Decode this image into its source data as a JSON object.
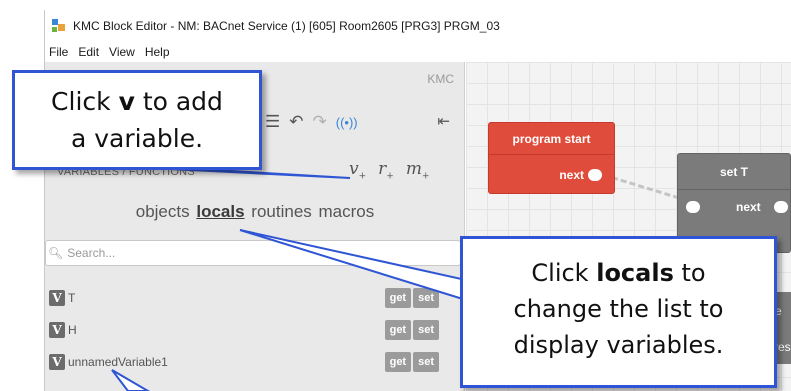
{
  "window": {
    "title": "KMC Block Editor - NM: BACnet Service (1) [605] Room2605 [PRG3] PRGM_03"
  },
  "menu": [
    "File",
    "Edit",
    "View",
    "Help"
  ],
  "panel": {
    "brand": "KMC",
    "section_header": "VARIABLES / FUNCTIONS",
    "add_buttons": [
      {
        "glyph": "v",
        "sub": "+"
      },
      {
        "glyph": "r",
        "sub": "+"
      },
      {
        "glyph": "m",
        "sub": "+"
      }
    ],
    "tabs": [
      {
        "label": "objects",
        "active": false
      },
      {
        "label": "locals",
        "active": true
      },
      {
        "label": "routines",
        "active": false
      },
      {
        "label": "macros",
        "active": false
      }
    ],
    "search_placeholder": "Search...",
    "variables": [
      {
        "badge": "V",
        "name": "T",
        "buttons": [
          "get",
          "set"
        ]
      },
      {
        "badge": "V",
        "name": "H",
        "buttons": [
          "get",
          "set"
        ]
      },
      {
        "badge": "V",
        "name": "unnamedVariable1",
        "buttons": [
          "get",
          "set"
        ]
      }
    ]
  },
  "canvas": {
    "blocks": [
      {
        "title": "program start",
        "port_label": "next",
        "color": "#e04c3b"
      },
      {
        "title": "set T",
        "port_label": "next",
        "color": "#7b7b7b"
      }
    ],
    "partial_text": [
      "e",
      "res"
    ]
  },
  "callouts": {
    "add_variable": {
      "pre": "Click ",
      "bold": "v",
      "post_line1": " to add",
      "line2": "a variable."
    },
    "locals": {
      "bold": "locals",
      "post": " to",
      "pre": "Click ",
      "line2": "change the list to",
      "line3": "display variables."
    }
  },
  "colors": {
    "callout_border": "#2f55d4",
    "accent": "#3a86d8"
  }
}
